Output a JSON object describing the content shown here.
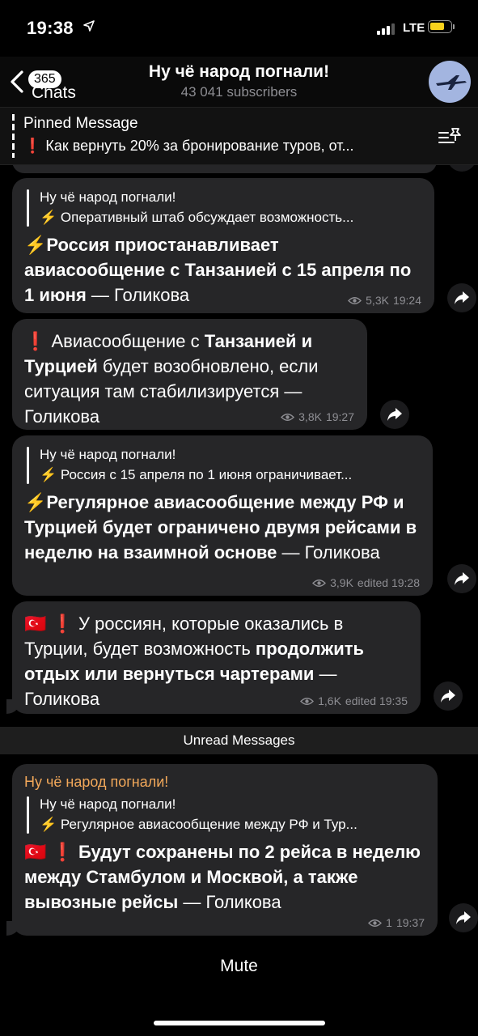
{
  "status_bar": {
    "time": "19:38",
    "network": "LTE"
  },
  "nav": {
    "back_label": "Chats",
    "unread_badge": "365",
    "title": "Ну чё народ погнали!",
    "subscribers": "43 041 subscribers"
  },
  "pinned": {
    "title": "Pinned Message",
    "text": "❗ Как вернуть 20% за бронирование туров, от..."
  },
  "messages": [
    {
      "quote_author": "Ну чё народ погнали!",
      "quote_text": "⚡ Оперативный штаб обсуждает возможность...",
      "text_bold": "⚡Россия приостанавливает авиасообщение с Танзанией с 15 апреля по 1 июня",
      "text_tail": " — Голикова",
      "views": "5,3K",
      "time": "19:24"
    },
    {
      "text_a": "❗ Авиасообщение с ",
      "text_b": "Танзанией и Турцией",
      "text_c": " будет возобновлено, если ситуация там стабилизируется — Голикова",
      "views": "3,8K",
      "time": "19:27"
    },
    {
      "quote_author": "Ну чё народ погнали!",
      "quote_text": "⚡ Россия с 15 апреля по 1 июня ограничивает...",
      "text_bold": "⚡Регулярное авиасообщение между РФ и Турцией будет ограничено двумя рейсами в неделю на взаимной основе",
      "text_tail": " — Голикова",
      "views": "3,9K",
      "time": "edited 19:28"
    },
    {
      "text_a": "🇹🇷 ❗ У россиян, которые оказались в Турции, будет возможность ",
      "text_b": "продолжить отдых или вернуться чартерами",
      "text_c": " — Голикова",
      "views": "1,6K",
      "time": "edited 19:35"
    },
    {
      "sender": "Ну чё народ погнали!",
      "quote_author": "Ну чё народ погнали!",
      "quote_text": "⚡ Регулярное авиасообщение между РФ и Тур...",
      "text_bold": "🇹🇷 ❗ Будут сохранены по 2 рейса в неделю между Стамбулом и Москвой, а также вывозные рейсы",
      "text_tail": " — Голикова",
      "views": "1",
      "time": "19:37"
    }
  ],
  "unread_label": "Unread Messages",
  "mute_label": "Mute",
  "colors": {
    "background": "#000000",
    "bubble": "#262628",
    "sender": "#f2a85a",
    "battery": "#f8d21c"
  }
}
